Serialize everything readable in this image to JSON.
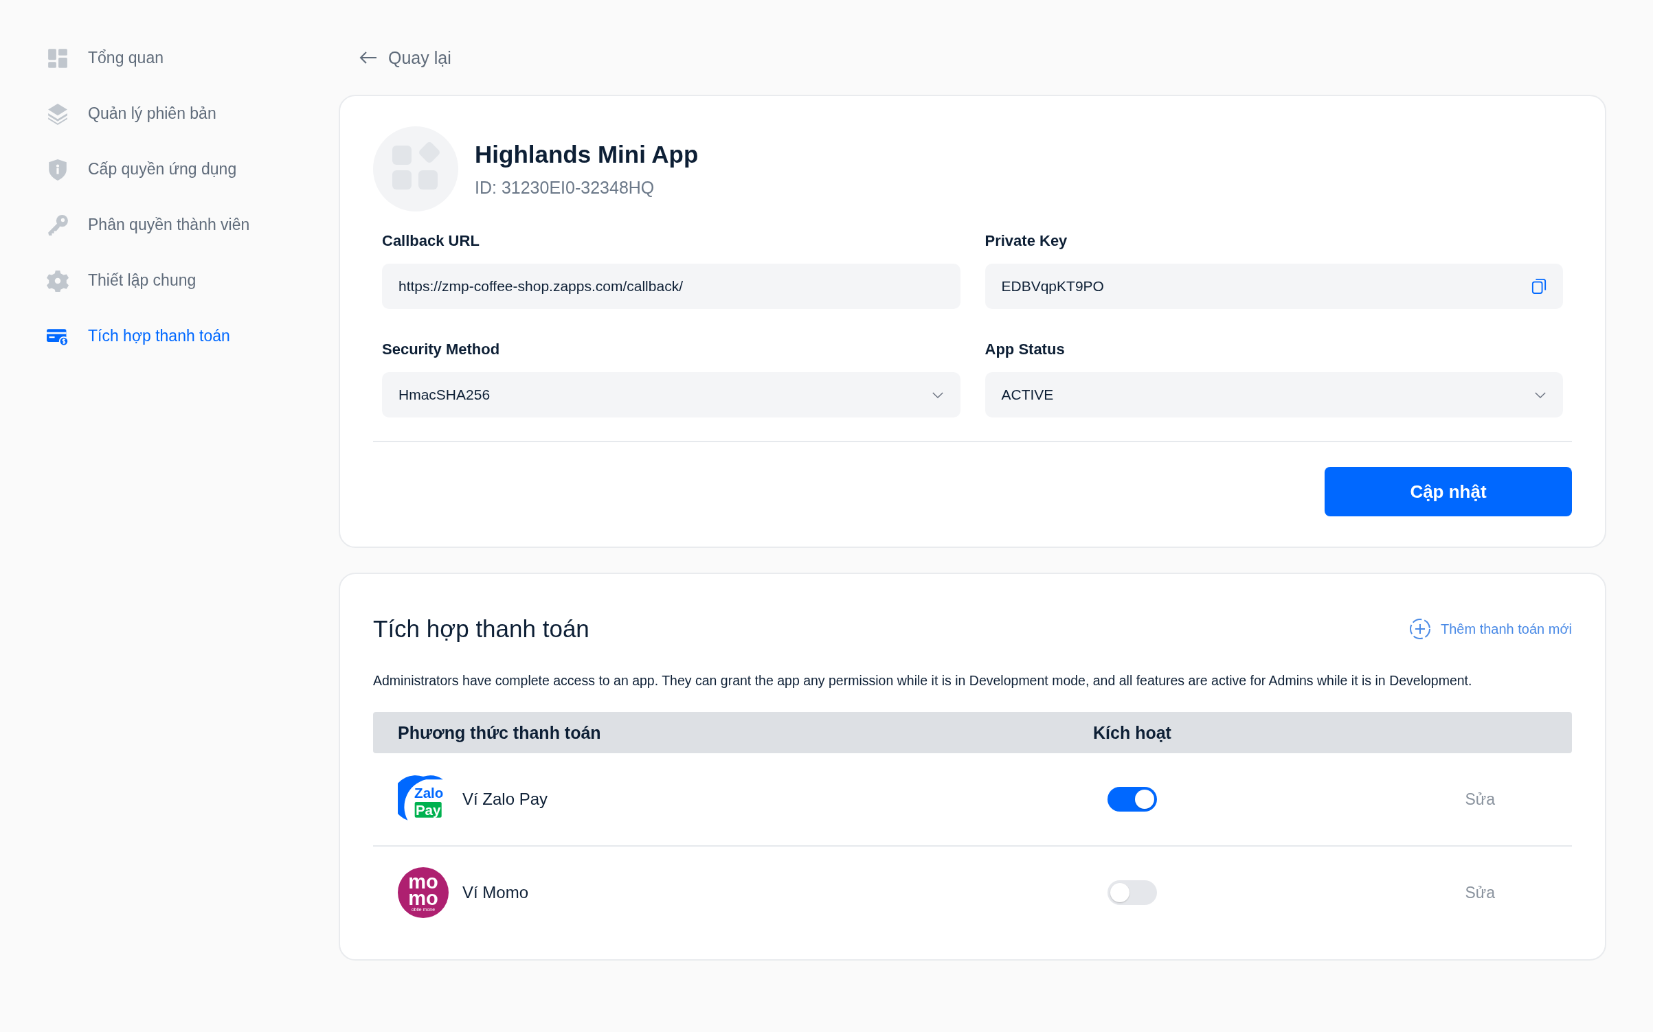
{
  "sidebar": {
    "items": [
      {
        "label": "Tổng quan",
        "selected": false
      },
      {
        "label": "Quản lý phiên bản",
        "selected": false
      },
      {
        "label": "Cấp quyền ứng dụng",
        "selected": false
      },
      {
        "label": "Phân quyền thành viên",
        "selected": false
      },
      {
        "label": "Thiết lập chung",
        "selected": false
      },
      {
        "label": "Tích hợp thanh toán",
        "selected": true
      }
    ]
  },
  "back_link": "Quay lại",
  "app": {
    "name": "Highlands Mini App",
    "id": "ID: 31230EI0-32348HQ",
    "fields": [
      {
        "label": "Callback URL",
        "value": "https://zmp-coffee-shop.zapps.com/callback/",
        "kind": "text"
      },
      {
        "label": "Private Key",
        "value": "EDBVqpKT9PO",
        "kind": "copy"
      },
      {
        "label": "Security Method",
        "value": "HmacSHA256",
        "kind": "select"
      },
      {
        "label": "App Status",
        "value": "ACTIVE",
        "kind": "select"
      }
    ],
    "update_button": "Cập nhật"
  },
  "payments": {
    "title": "Tích hợp thanh toán",
    "add_link": "Thêm thanh toán mới",
    "description": "Administrators have complete access to an app. They can grant the app any permission while it is in Development mode, and all features are active for Admins while it is in Development.",
    "table": {
      "columns": [
        "Phương thức thanh toán",
        "Kích hoạt"
      ],
      "rows": [
        {
          "name": "Ví Zalo Pay",
          "kind": "zalopay",
          "logo_text": [
            "Zalo",
            "Pay"
          ],
          "on": true,
          "action": "Sửa"
        },
        {
          "name": "Ví Momo",
          "kind": "momo",
          "logo_text": [
            "mo",
            "mo",
            "obile mone"
          ],
          "on": false,
          "action": "Sửa"
        }
      ]
    }
  }
}
